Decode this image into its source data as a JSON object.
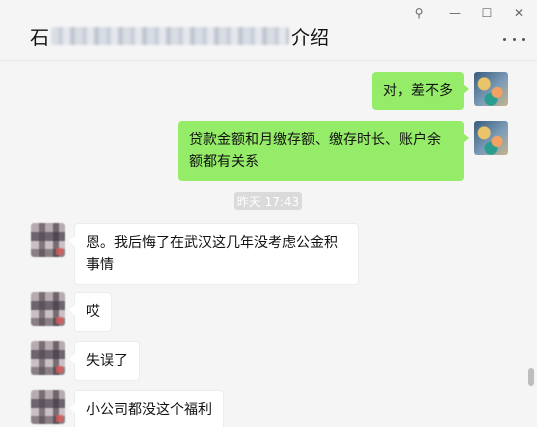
{
  "window": {
    "title_prefix": "石",
    "title_suffix": "介绍",
    "controls": {
      "pin": "⚲",
      "minimize": "—",
      "maximize": "☐",
      "close": "✕"
    }
  },
  "messages": [
    {
      "side": "me",
      "text": "对，差不多"
    },
    {
      "side": "me",
      "text": "贷款金额和月缴存额、缴存时长、账户余额都有关系"
    },
    {
      "side": "them",
      "text": "恩。我后悔了在武汉这几年没考虑公金积事情"
    },
    {
      "side": "them",
      "text": "哎"
    },
    {
      "side": "them",
      "text": "失误了"
    },
    {
      "side": "them",
      "text": "小公司都没这个福利"
    }
  ],
  "timestamp": "昨天 17:43",
  "colors": {
    "self_bubble": "#95ec69",
    "other_bubble": "#ffffff",
    "background": "#f5f5f5",
    "timestamp_bg": "#dadada"
  },
  "icons": {
    "more": "more-icon"
  }
}
